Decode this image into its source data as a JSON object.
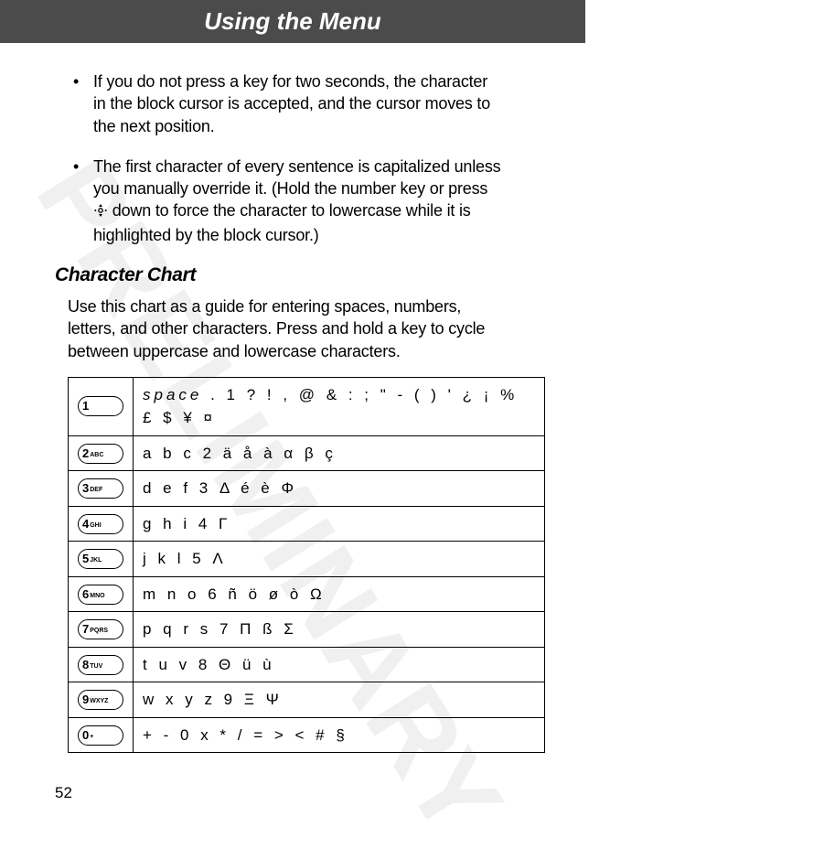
{
  "header": {
    "title": "Using the Menu"
  },
  "watermark": "PRELIMINARY",
  "bullets": [
    "If you do not press a key for two seconds, the character in the block cursor is accepted, and the cursor moves to the next position.",
    "The first character of every sentence is capitalized unless you manually override it. (Hold the number key or press    down to force the character to lowercase while it is highlighted by the block cursor.)"
  ],
  "section_heading": "Character Chart",
  "intro": "Use this chart as a guide for entering spaces, numbers, letters, and other characters. Press and hold a key to cycle between uppercase and lowercase characters.",
  "chart_data": {
    "type": "table",
    "title": "Character Chart",
    "rows": [
      {
        "key_num": "1",
        "key_label": "",
        "chars": "space . 1 ? ! , @ & : ; \" - ( ) ' ¿ ¡ % £ $ ¥ ¤"
      },
      {
        "key_num": "2",
        "key_label": "ABC",
        "chars": "a b c 2 ä å à α β ç"
      },
      {
        "key_num": "3",
        "key_label": "DEF",
        "chars": "d e f 3 Δ é è Φ"
      },
      {
        "key_num": "4",
        "key_label": "GHI",
        "chars": "g h i 4 Γ"
      },
      {
        "key_num": "5",
        "key_label": "JKL",
        "chars": "j k l 5 Λ"
      },
      {
        "key_num": "6",
        "key_label": "MNO",
        "chars": "m n o 6 ñ ö ø ò Ω"
      },
      {
        "key_num": "7",
        "key_label": "PQRS",
        "chars": "p q r s 7 Π ß Σ"
      },
      {
        "key_num": "8",
        "key_label": "TUV",
        "chars": "t u v 8 Θ ü ù"
      },
      {
        "key_num": "9",
        "key_label": "WXYZ",
        "chars": "w x y z 9 Ξ Ψ"
      },
      {
        "key_num": "0",
        "key_label": "+",
        "chars": "+ - 0 x * / = > < # §"
      }
    ]
  },
  "page_number": "52"
}
